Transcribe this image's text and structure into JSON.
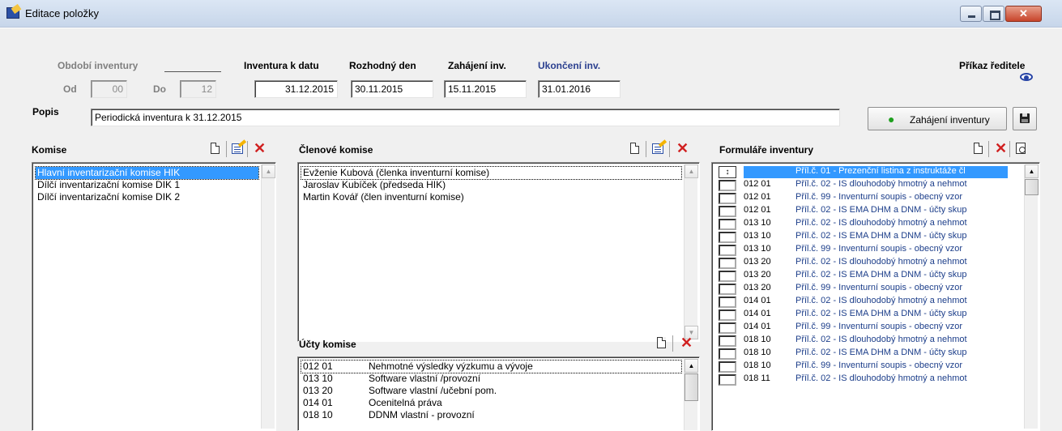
{
  "window": {
    "title": "Editace položky"
  },
  "header": {
    "obdobi_label": "Období inventury",
    "od_label": "Od",
    "od_value": "00",
    "do_label": "Do",
    "do_value": "12",
    "inventura_label": "Inventura k datu",
    "inventura_value": "31.12.2015",
    "rozhodny_label": "Rozhodný den",
    "rozhodny_value": "30.11.2015",
    "zahajeni_label": "Zahájení inv.",
    "zahajeni_value": "15.11.2015",
    "ukonceni_label": "Ukončení inv.",
    "ukonceni_value": "31.01.2016",
    "prikaz_label": "Příkaz ředitele",
    "popis_label": "Popis",
    "popis_value": "Periodická inventura k 31.12.2015",
    "zahajeni_button": "Zahájení inventury"
  },
  "komise": {
    "title": "Komise",
    "items": [
      "Hlavní inventarizační komise HIK",
      "Dílčí inventarizační komise DIK 1",
      "Dílčí inventarizační komise DIK 2"
    ]
  },
  "clenove": {
    "title": "Členové komise",
    "items": [
      "Evženie Kubová (členka inventurní komise)",
      "Jaroslav Kubíček (předseda HIK)",
      "Martin Kovář (člen inventurní komise)"
    ]
  },
  "ucty": {
    "title": "Účty komise",
    "items": [
      {
        "code": "012 01",
        "name": "Nehmotné výsledky výzkumu a vývoje"
      },
      {
        "code": "013 10",
        "name": "Software vlastní /provozní"
      },
      {
        "code": "013 20",
        "name": "Software vlastní /učební pom."
      },
      {
        "code": "014 01",
        "name": "Ocenitelná práva"
      },
      {
        "code": "018 10",
        "name": "DDNM vlastní - provozní"
      }
    ]
  },
  "formulare": {
    "title": "Formuláře inventury",
    "rows": [
      {
        "code": "",
        "text": "Příl.č. 01 - Prezenční listina z instruktáže čl"
      },
      {
        "code": "012 01",
        "text": "Příl.č. 02 - IS dlouhodobý hmotný a nehmot"
      },
      {
        "code": "012 01",
        "text": "Příl.č. 99 - Inventurní soupis - obecný vzor"
      },
      {
        "code": "012 01",
        "text": "Příl.č. 02 - IS EMA DHM a DNM - účty skup"
      },
      {
        "code": "013 10",
        "text": "Příl.č. 02 - IS dlouhodobý hmotný a nehmot"
      },
      {
        "code": "013 10",
        "text": "Příl.č. 02 - IS EMA DHM a DNM - účty skup"
      },
      {
        "code": "013 10",
        "text": "Příl.č. 99 - Inventurní soupis - obecný vzor"
      },
      {
        "code": "013 20",
        "text": "Příl.č. 02 - IS dlouhodobý hmotný a nehmot"
      },
      {
        "code": "013 20",
        "text": "Příl.č. 02 - IS EMA DHM a DNM - účty skup"
      },
      {
        "code": "013 20",
        "text": "Příl.č. 99 - Inventurní soupis - obecný vzor"
      },
      {
        "code": "014 01",
        "text": "Příl.č. 02 - IS dlouhodobý hmotný a nehmot"
      },
      {
        "code": "014 01",
        "text": "Příl.č. 02 - IS EMA DHM a DNM - účty skup"
      },
      {
        "code": "014 01",
        "text": "Příl.č. 99 - Inventurní soupis - obecný vzor"
      },
      {
        "code": "018 10",
        "text": "Příl.č. 02 - IS dlouhodobý hmotný a nehmot"
      },
      {
        "code": "018 10",
        "text": "Příl.č. 02 - IS EMA DHM a DNM - účty skup"
      },
      {
        "code": "018 10",
        "text": "Příl.č. 99 - Inventurní soupis - obecný vzor"
      },
      {
        "code": "018 11",
        "text": "Příl.č. 02 - IS dlouhodobý hmotný a nehmot"
      }
    ]
  },
  "icons": {
    "updown": "↕",
    "del": "✕",
    "scroll_up": "▲",
    "scroll_down": "▼"
  },
  "colors": {
    "selection": "#3399ff",
    "delete": "#d02020",
    "link_text": "#1c3e8a"
  }
}
